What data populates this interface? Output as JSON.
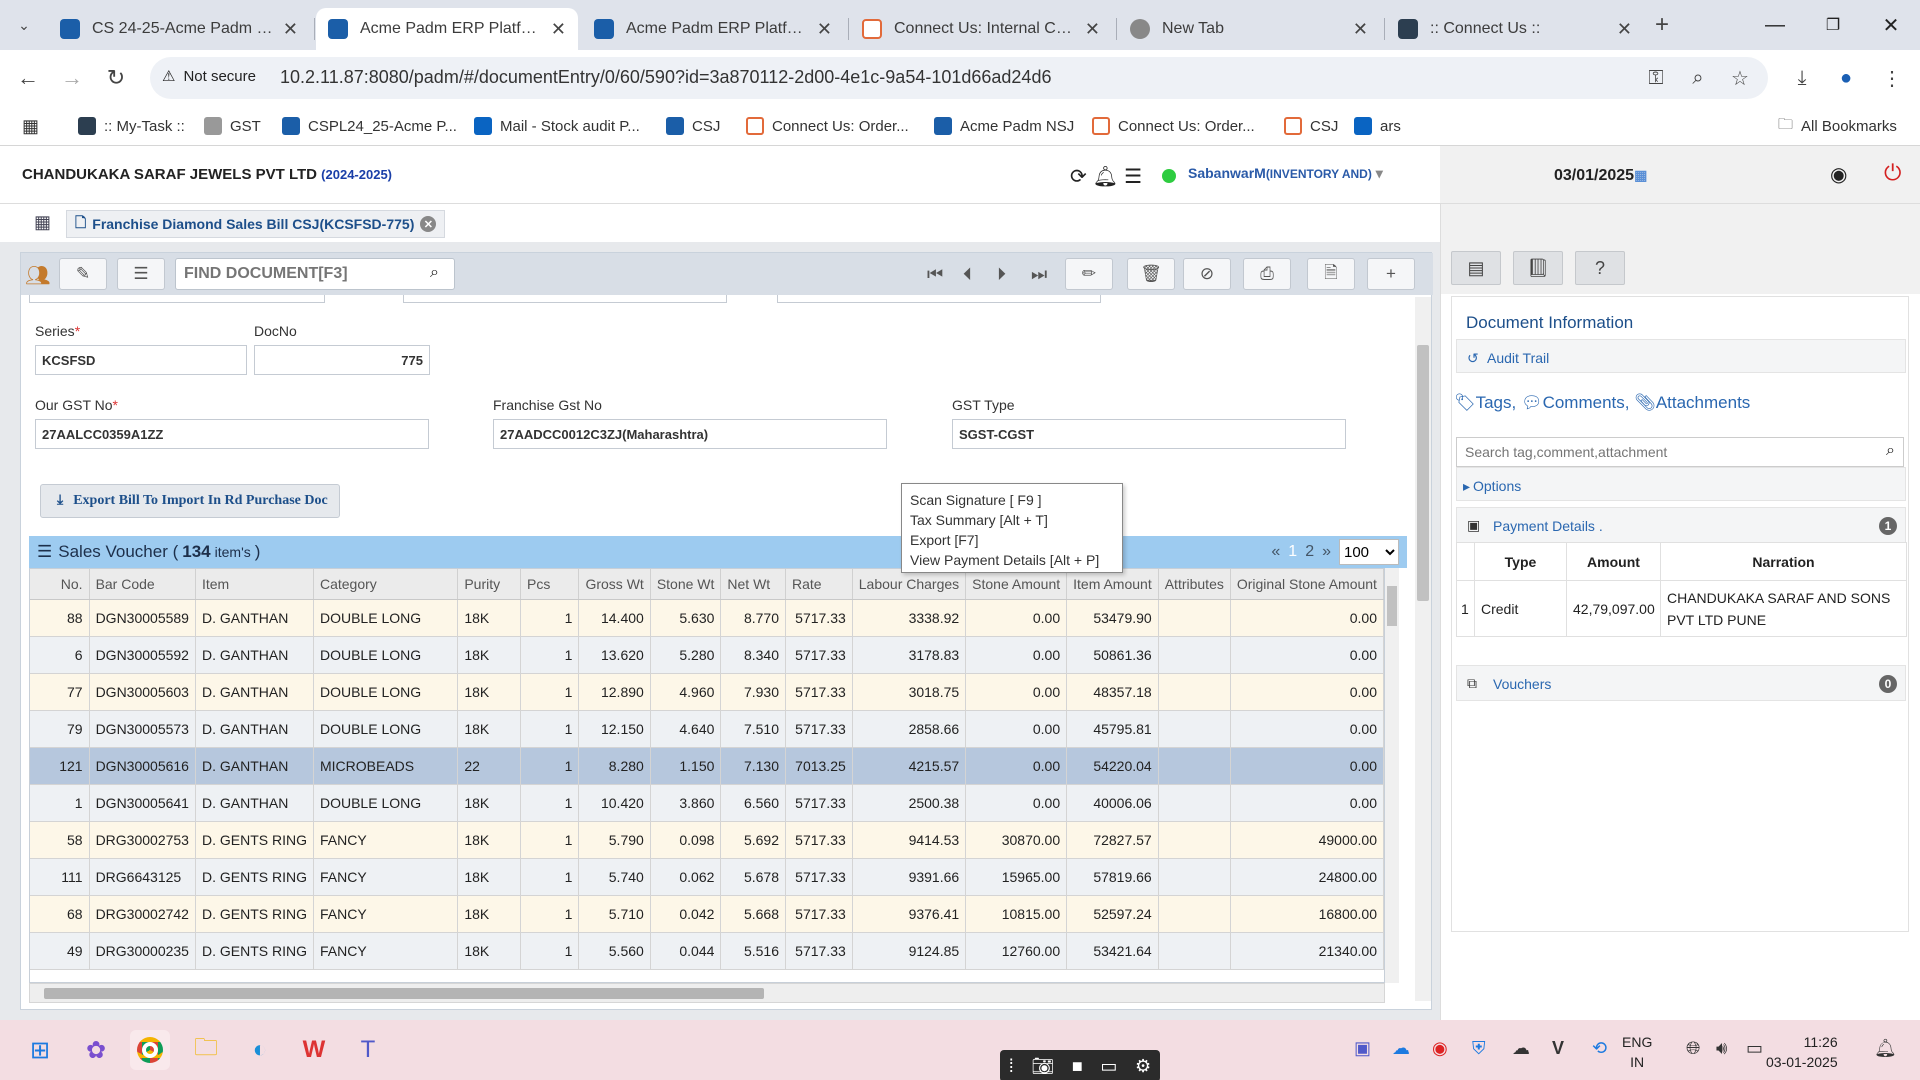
{
  "browser": {
    "tabs": [
      {
        "title": "CS 24-25-Acme Padm ERP",
        "color": "#1b5ea8"
      },
      {
        "title": "Acme Padm ERP Platform",
        "color": "#1b5ea8",
        "active": true
      },
      {
        "title": "Acme Padm ERP Platform",
        "color": "#1b5ea8"
      },
      {
        "title": "Connect Us: Internal Comm",
        "color": "#e26a3a"
      },
      {
        "title": "New Tab",
        "color": "#666666"
      },
      {
        "title": ":: Connect Us ::",
        "color": "#2c3e50"
      }
    ],
    "security_label": "Not secure",
    "url": "10.2.11.87:8080/padm/#/documentEntry/0/60/590?id=3a870112-2d00-4e1c-9a54-101d66ad24d6",
    "bookmarks": [
      ":: My-Task ::",
      "GST",
      "CSPL24_25-Acme P...",
      "Mail - Stock audit P...",
      "CSJ",
      "Connect Us: Order...",
      "Acme Padm NSJ",
      "Connect Us: Order...",
      "CSJ",
      "ars"
    ],
    "all_bookmarks": "All Bookmarks"
  },
  "app": {
    "company": "CHANDUKAKA SARAF JEWELS PVT LTD",
    "year": "(2024-2025)",
    "user": "SabanwarM",
    "role": "(INVENTORY AND)",
    "date": "03/01/2025",
    "doc_tab": "Franchise Diamond Sales Bill CSJ(KCSFSD-775)",
    "find_placeholder": "FIND DOCUMENT[F3]"
  },
  "form": {
    "series_label": "Series",
    "series_value": "KCSFSD",
    "docno_label": "DocNo",
    "docno_value": "775",
    "gst_label": "Our GST No",
    "gst_value": "27AALCC0359A1ZZ",
    "fgst_label": "Franchise Gst No",
    "fgst_value": "27AADCC0012C3ZJ(Maharashtra)",
    "gsttype_label": "GST Type",
    "gsttype_value": "SGST-CGST",
    "export_button": "Export Bill To Import In Rd Purchase Doc"
  },
  "context_menu": [
    "Scan Signature [ F9 ]",
    "Tax Summary [Alt + T]",
    "Export [F7]",
    "View Payment Details [Alt + P]"
  ],
  "voucher": {
    "title": "Sales Voucher (",
    "count": "134",
    "items_suffix": "item's",
    "close_paren": ")",
    "pager_prev": "«",
    "page1": "1",
    "page2": "2",
    "pager_next": "»",
    "page_size": "100",
    "columns": [
      "No.",
      "Bar Code",
      "Item",
      "Category",
      "Purity",
      "Pcs",
      "Gross Wt",
      "Stone Wt",
      "Net Wt",
      "Rate",
      "Labour Charges",
      "Stone Amount",
      "Item Amount",
      "Attributes",
      "Original Stone Amount"
    ],
    "rows": [
      [
        "88",
        "DGN30005589",
        "D. GANTHAN",
        "DOUBLE LONG",
        "18K",
        "1",
        "14.400",
        "5.630",
        "8.770",
        "5717.33",
        "3338.92",
        "0.00",
        "53479.90",
        "",
        "0.00"
      ],
      [
        "6",
        "DGN30005592",
        "D. GANTHAN",
        "DOUBLE LONG",
        "18K",
        "1",
        "13.620",
        "5.280",
        "8.340",
        "5717.33",
        "3178.83",
        "0.00",
        "50861.36",
        "",
        "0.00"
      ],
      [
        "77",
        "DGN30005603",
        "D. GANTHAN",
        "DOUBLE LONG",
        "18K",
        "1",
        "12.890",
        "4.960",
        "7.930",
        "5717.33",
        "3018.75",
        "0.00",
        "48357.18",
        "",
        "0.00"
      ],
      [
        "79",
        "DGN30005573",
        "D. GANTHAN",
        "DOUBLE LONG",
        "18K",
        "1",
        "12.150",
        "4.640",
        "7.510",
        "5717.33",
        "2858.66",
        "0.00",
        "45795.81",
        "",
        "0.00"
      ],
      [
        "121",
        "DGN30005616",
        "D. GANTHAN",
        "MICROBEADS",
        "22",
        "1",
        "8.280",
        "1.150",
        "7.130",
        "7013.25",
        "4215.57",
        "0.00",
        "54220.04",
        "",
        "0.00"
      ],
      [
        "1",
        "DGN30005641",
        "D. GANTHAN",
        "DOUBLE LONG",
        "18K",
        "1",
        "10.420",
        "3.860",
        "6.560",
        "5717.33",
        "2500.38",
        "0.00",
        "40006.06",
        "",
        "0.00"
      ],
      [
        "58",
        "DRG30002753",
        "D. GENTS RING",
        "FANCY",
        "18K",
        "1",
        "5.790",
        "0.098",
        "5.692",
        "5717.33",
        "9414.53",
        "30870.00",
        "72827.57",
        "",
        "49000.00"
      ],
      [
        "111",
        "DRG6643125",
        "D. GENTS RING",
        "FANCY",
        "18K",
        "1",
        "5.740",
        "0.062",
        "5.678",
        "5717.33",
        "9391.66",
        "15965.00",
        "57819.66",
        "",
        "24800.00"
      ],
      [
        "68",
        "DRG30002742",
        "D. GENTS RING",
        "FANCY",
        "18K",
        "1",
        "5.710",
        "0.042",
        "5.668",
        "5717.33",
        "9376.41",
        "10815.00",
        "52597.24",
        "",
        "16800.00"
      ],
      [
        "49",
        "DRG30000235",
        "D. GENTS RING",
        "FANCY",
        "18K",
        "1",
        "5.560",
        "0.044",
        "5.516",
        "5717.33",
        "9124.85",
        "12760.00",
        "53421.64",
        "",
        "21340.00"
      ]
    ]
  },
  "side": {
    "doc_info_title": "Document Information",
    "audit_trail": "Audit Trail",
    "tags": "Tags,",
    "comments": "Comments,",
    "attachments": "Attachments",
    "search_placeholder": "Search tag,comment,attachment",
    "options": "Options",
    "payment_title": "Payment Details .",
    "payment_count": "1",
    "pay_cols": [
      "Type",
      "Amount",
      "Narration"
    ],
    "pay_row": {
      "no": "1",
      "type": "Credit",
      "amount": "42,79,097.00",
      "narration": "CHANDUKAKA SARAF AND SONS PVT LTD PUNE"
    },
    "vouchers": "Vouchers",
    "vouchers_count": "0"
  },
  "taskbar": {
    "lang1": "ENG",
    "lang2": "IN",
    "time": "11:26",
    "date": "03-01-2025"
  }
}
